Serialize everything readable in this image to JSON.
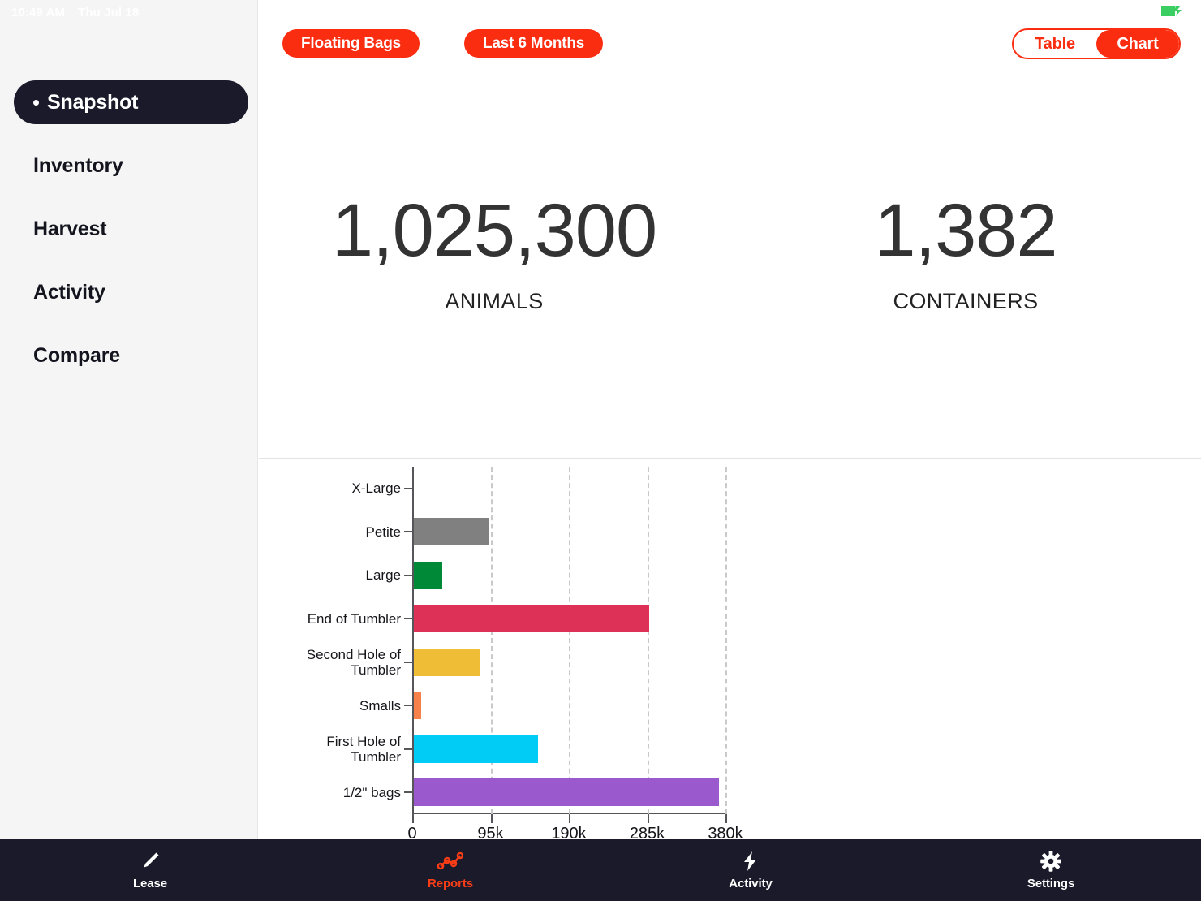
{
  "statusbar": {
    "time": "10:49 AM",
    "date": "Thu Jul 18",
    "battery_icon": "battery-charging-icon"
  },
  "sidebar": {
    "items": [
      {
        "label": "Snapshot",
        "active": true
      },
      {
        "label": "Inventory",
        "active": false
      },
      {
        "label": "Harvest",
        "active": false
      },
      {
        "label": "Activity",
        "active": false
      },
      {
        "label": "Compare",
        "active": false
      }
    ]
  },
  "topbar": {
    "filters": [
      {
        "label": "Floating Bags"
      },
      {
        "label": "Last 6 Months"
      }
    ],
    "view_toggle": {
      "options": [
        {
          "label": "Table",
          "selected": false
        },
        {
          "label": "Chart",
          "selected": true
        }
      ]
    },
    "accent_color": "#fb2d11"
  },
  "kpis": [
    {
      "value": "1,025,300",
      "label": "ANIMALS"
    },
    {
      "value": "1,382",
      "label": "CONTAINERS"
    }
  ],
  "chart_data": {
    "type": "bar",
    "orientation": "horizontal",
    "title": "",
    "xlabel": "",
    "ylabel": "",
    "xlim": [
      0,
      380000
    ],
    "xticks": [
      0,
      95000,
      190000,
      285000,
      380000
    ],
    "xtick_labels": [
      "0",
      "95k",
      "190k",
      "285k",
      "380k"
    ],
    "grid": "vertical-dashed",
    "legend": "none",
    "categories": [
      "X-Large",
      "Petite",
      "Large",
      "End of Tumbler",
      "Second Hole of\nTumbler",
      "Smalls",
      "First Hole of\nTumbler",
      "1/2\" bags"
    ],
    "values": [
      0,
      92000,
      34500,
      285000,
      80000,
      9000,
      151000,
      370000
    ],
    "colors": [
      "#ffffff",
      "#808080",
      "#008a38",
      "#dd3158",
      "#efbe36",
      "#f7814b",
      "#00ccf5",
      "#9b59ce"
    ]
  },
  "tabbar": {
    "tabs": [
      {
        "label": "Lease",
        "icon": "pencil-icon",
        "active": false
      },
      {
        "label": "Reports",
        "icon": "line-chart-icon",
        "active": true
      },
      {
        "label": "Activity",
        "icon": "lightning-bolt-icon",
        "active": false
      },
      {
        "label": "Settings",
        "icon": "gear-icon",
        "active": false
      }
    ],
    "active_color": "#fb3d17"
  }
}
